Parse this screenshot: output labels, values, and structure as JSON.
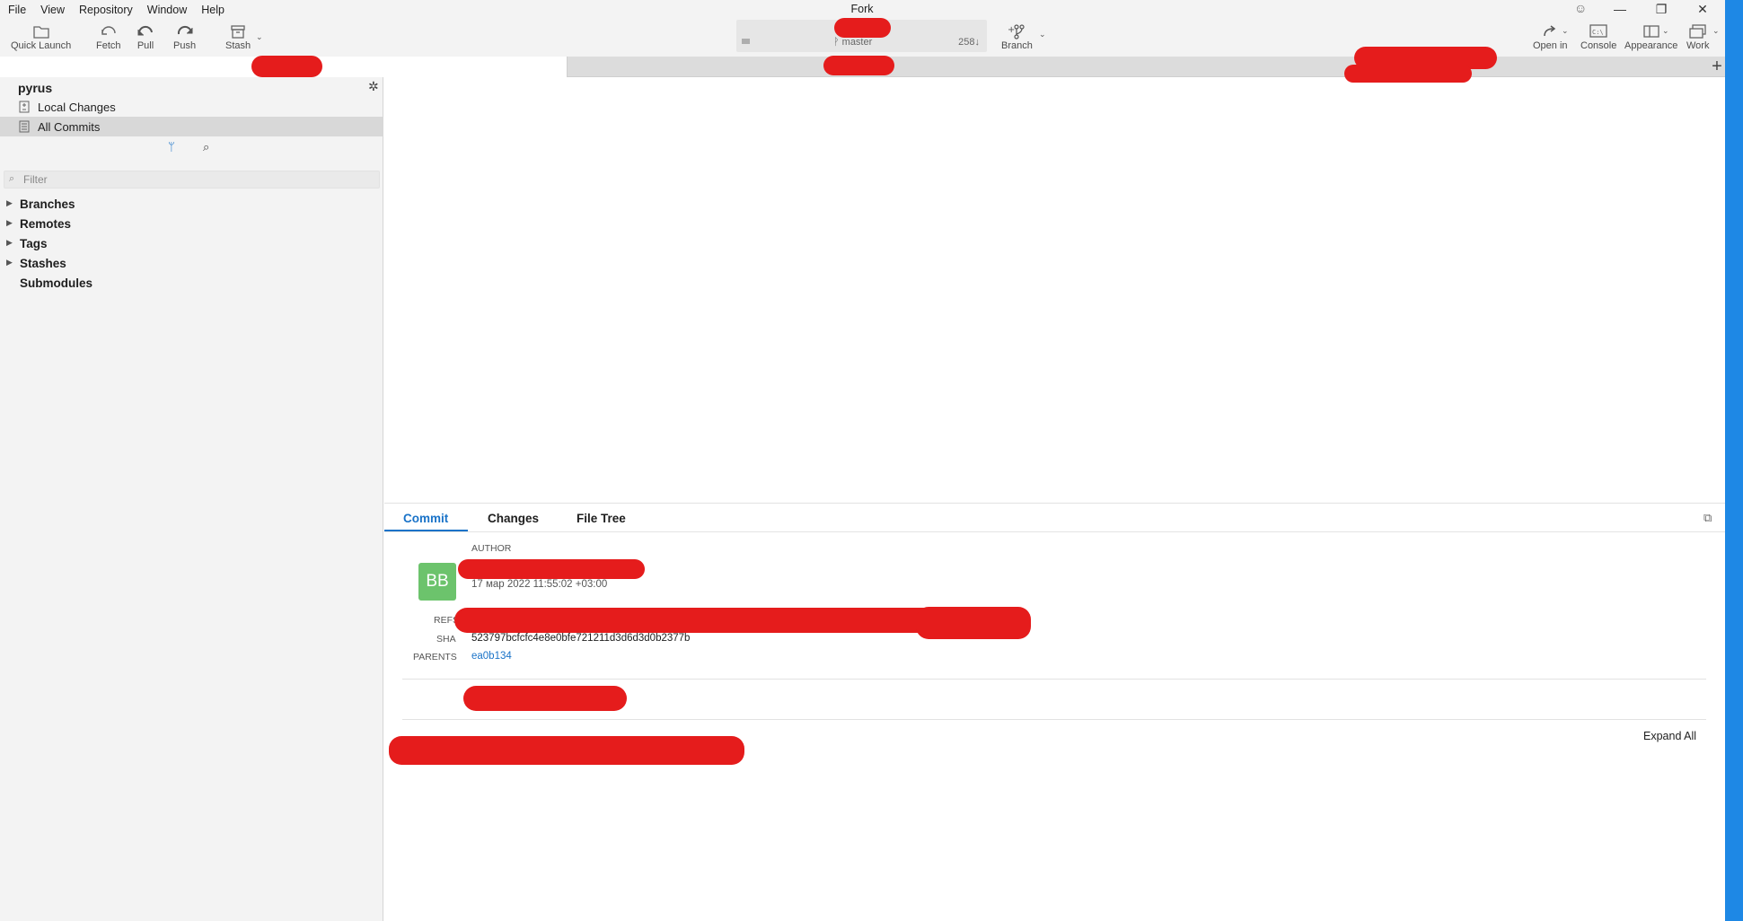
{
  "window": {
    "title": "Fork",
    "menu": [
      "File",
      "View",
      "Repository",
      "Window",
      "Help"
    ],
    "controls": {
      "minimize": "—",
      "maximize": "❐",
      "close": "✕"
    }
  },
  "toolbar": {
    "quick_launch": "Quick Launch",
    "fetch": "Fetch",
    "pull": "Pull",
    "push": "Push",
    "stash": "Stash",
    "branch": "Branch",
    "open_in": "Open in",
    "console": "Console",
    "appearance": "Appearance",
    "work": "Work",
    "repo_branch": "master",
    "repo_count": "258↓"
  },
  "tabs": {
    "add": "+"
  },
  "sidebar": {
    "repo_name": "pyrus",
    "nav": [
      {
        "label": "Local Changes",
        "icon": "local-changes-icon"
      },
      {
        "label": "All Commits",
        "icon": "all-commits-icon",
        "selected": true
      }
    ],
    "filter_placeholder": "Filter",
    "tree": [
      {
        "label": "Branches",
        "expandable": true
      },
      {
        "label": "Remotes",
        "expandable": true
      },
      {
        "label": "Tags",
        "expandable": true
      },
      {
        "label": "Stashes",
        "expandable": true
      },
      {
        "label": "Submodules",
        "expandable": false
      }
    ]
  },
  "details": {
    "tabs": [
      "Commit",
      "Changes",
      "File Tree"
    ],
    "active_tab": "Commit",
    "author_label": "AUTHOR",
    "avatar_initials": "BB",
    "date": "17 мар 2022 11:55:02 +03:00",
    "refs_label": "REFS",
    "sha_label": "SHA",
    "sha": "523797bcfcfc4e8e0bfe721211d3d6d3d0b2377b",
    "parents_label": "PARENTS",
    "parent": "ea0b134",
    "expand_all": "Expand All"
  },
  "colors": {
    "accent": "#1a73c8",
    "avatar": "#6cc36c",
    "redaction": "#e51c1c",
    "right_bar": "#1e88e5"
  }
}
